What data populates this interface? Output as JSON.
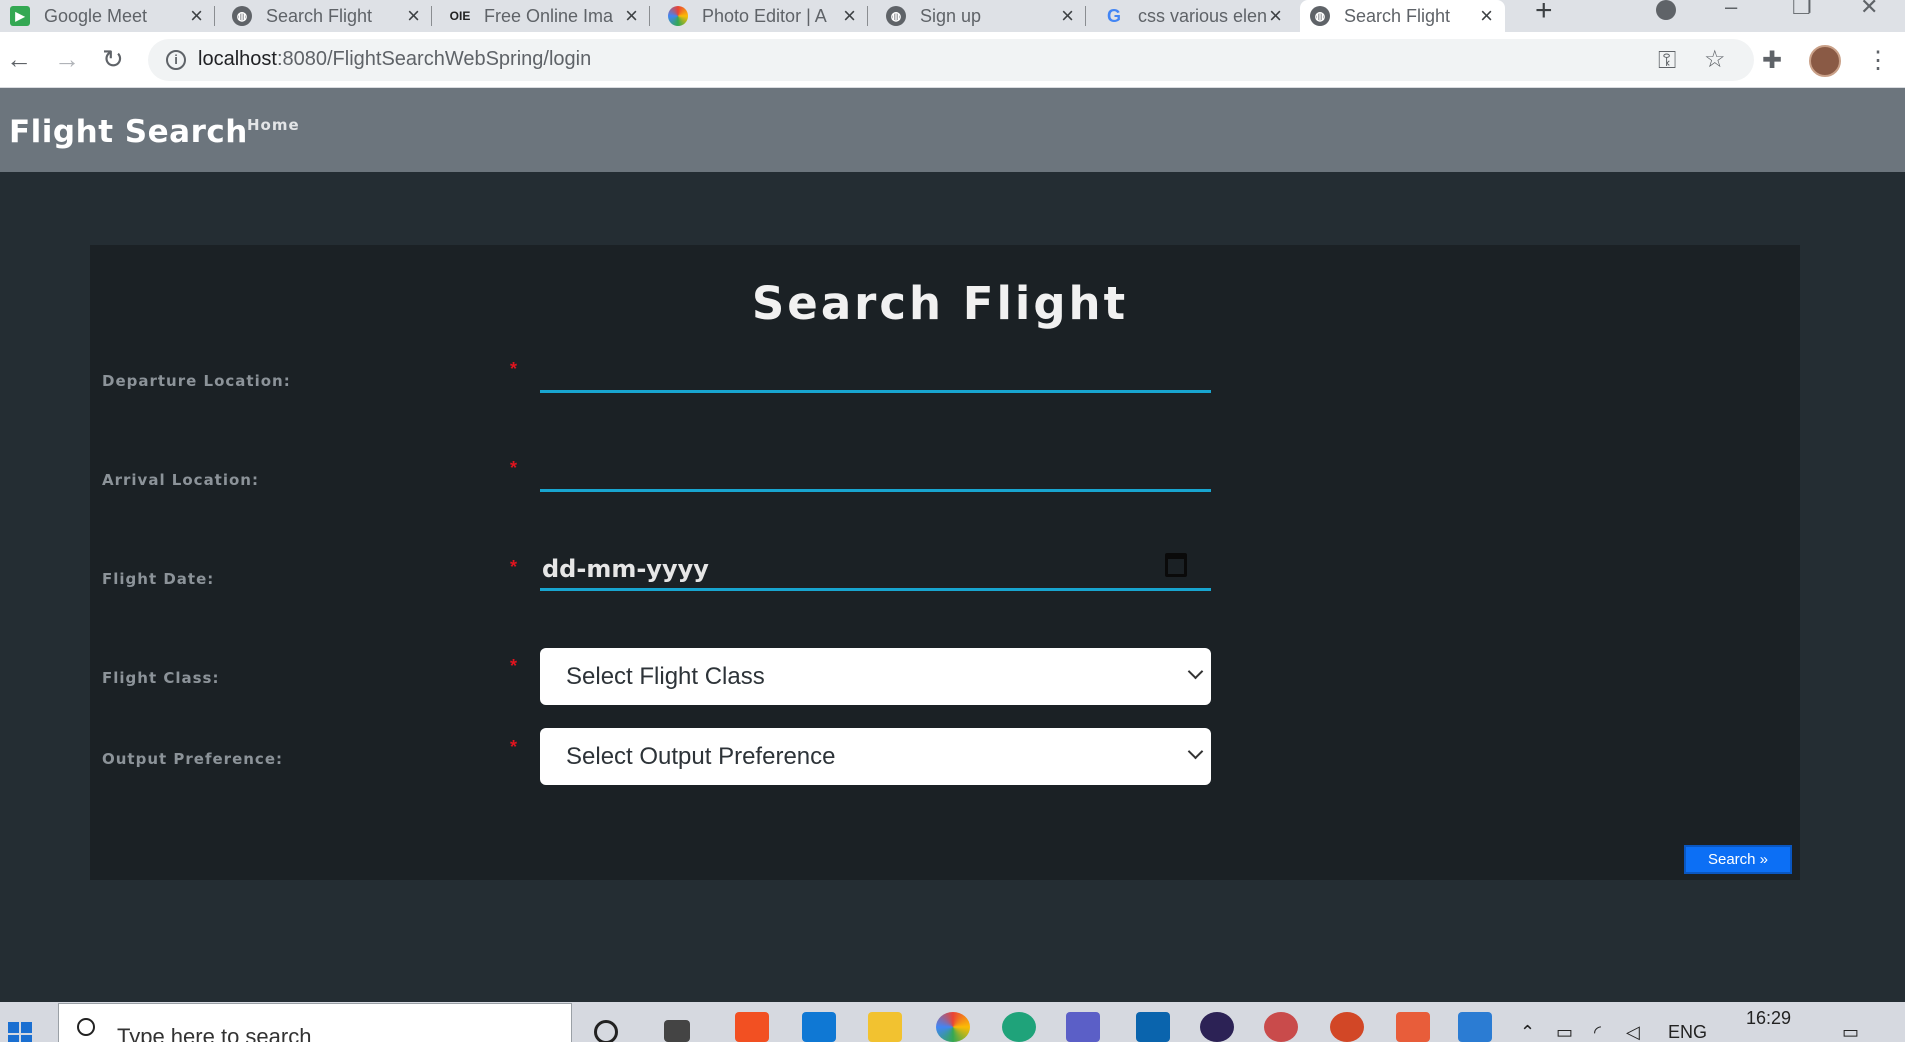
{
  "browser": {
    "tabs": [
      {
        "title": "Google Meet",
        "icon": "google-meet-icon",
        "color": "#ea4335"
      },
      {
        "title": "Search Flight",
        "icon": "globe-icon",
        "color": "#5f6368"
      },
      {
        "title": "Free Online Ima",
        "icon": "oie-icon",
        "color": "#222222"
      },
      {
        "title": "Photo Editor | A",
        "icon": "photo-editor-icon",
        "color": "#fbbc04"
      },
      {
        "title": "Sign up",
        "icon": "globe-icon",
        "color": "#5f6368"
      },
      {
        "title": "css various elen",
        "icon": "google-icon",
        "color": "#4285f4"
      },
      {
        "title": "Search Flight",
        "icon": "globe-icon",
        "color": "#5f6368"
      }
    ],
    "url_host": "localhost",
    "url_path": ":8080/FlightSearchWebSpring/login"
  },
  "navbar": {
    "brand": "Flight Search",
    "home": "Home"
  },
  "form": {
    "title": "Search Flight",
    "required_mark": "*",
    "fields": {
      "departure": {
        "label": "Departure Location:",
        "value": ""
      },
      "arrival": {
        "label": "Arrival Location:",
        "value": ""
      },
      "date": {
        "label": "Flight Date:",
        "placeholder": "dd-mm-yyyy"
      },
      "flight_class": {
        "label": "Flight Class:",
        "selected": "Select Flight Class"
      },
      "output_pref": {
        "label": "Output Preference:",
        "selected": "Select Output Preference"
      }
    },
    "search_button": "Search »"
  },
  "taskbar": {
    "search_placeholder": "Type here to search",
    "lang": "ENG",
    "time": "16:29"
  },
  "colors": {
    "page_bg": "#242d33",
    "navbar_bg": "#6c757d",
    "card_bg": "#1b2125",
    "input_underline": "#18a5d0",
    "required": "#e0141e",
    "button": "#0c6ff5"
  }
}
